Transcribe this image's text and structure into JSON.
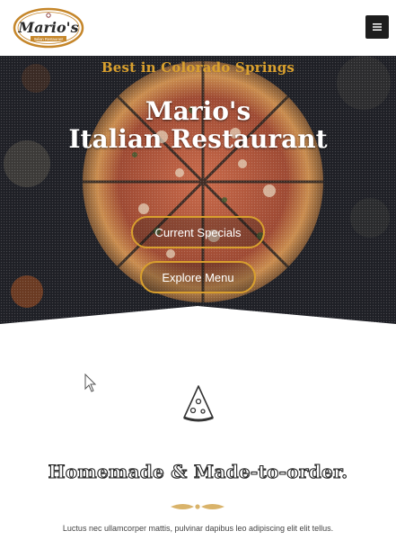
{
  "header": {
    "logo_text": "Mario's",
    "logo_subtext": "Italian Restaurant",
    "menu_icon": "hamburger-icon"
  },
  "hero": {
    "tagline": "Best in Colorado Springs",
    "title_line1": "Mario's",
    "title_line2": "Italian Restaurant",
    "buttons": [
      {
        "label": "Current Specials"
      },
      {
        "label": "Explore Menu"
      }
    ]
  },
  "section": {
    "icon": "pizza-slice-icon",
    "title": "Homemade & Made-to-order.",
    "divider_icon": "ornament-divider-icon",
    "text": "Luctus nec ullamcorper mattis, pulvinar dapibus leo adipiscing elit elit tellus."
  },
  "colors": {
    "accent": "#d9a02e",
    "hero_bg": "#1e1f24",
    "menu_button": "#1d1d1d",
    "text_dark": "#222222"
  }
}
